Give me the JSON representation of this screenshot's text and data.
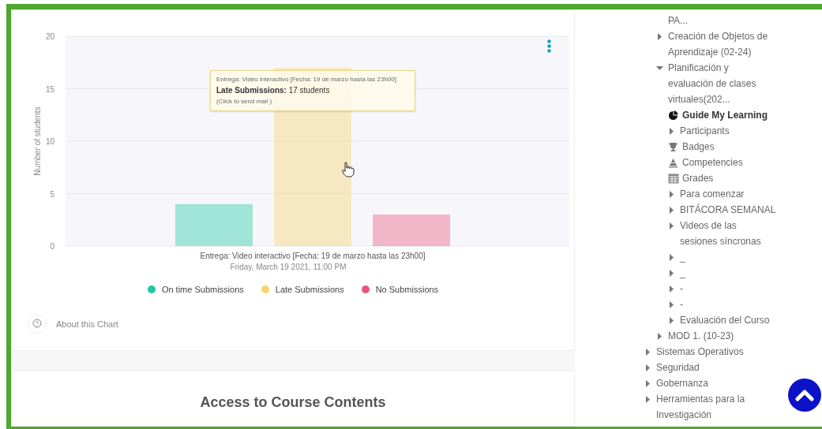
{
  "chart_card": {
    "chart_data": {
      "type": "bar",
      "ylabel": "Number of students",
      "categories": [
        "Entrega: Video interactivo [Fecha: 19 de marzo hasta las 23h00]"
      ],
      "series": [
        {
          "name": "On time Submissions",
          "color": "#1fc9a2",
          "values": [
            4
          ]
        },
        {
          "name": "Late Submissions",
          "color": "#f6d56b",
          "values": [
            17
          ]
        },
        {
          "name": "No Submissions",
          "color": "#e8557b",
          "values": [
            3
          ]
        }
      ],
      "ylim": [
        0,
        20
      ],
      "yticks": [
        0,
        5,
        10,
        15,
        20
      ],
      "grid": true
    },
    "date_label": "Friday, March 19 2021, 11:00 PM",
    "tooltip": {
      "title": "Entrega: Video interactivo [Fecha: 19 de marzo hasta las 23h00]",
      "value": "**Late Submissions:** 17 students",
      "hint": "(Click to send mail )"
    },
    "about_link": "About this Chart"
  },
  "next_card": {
    "title": "Access to Course Contents"
  },
  "sidebar": {
    "tree": [
      {
        "kind": "group",
        "children": [
          {
            "kind": "text",
            "label": "PA...",
            "selected": false
          },
          {
            "kind": "branch",
            "label": "Creación de Objetos de Aprendizaje (02-24)",
            "expanded": false,
            "selected": false
          },
          {
            "kind": "branch",
            "label": "Planificación y evaluación de clases virtuales(202...",
            "expanded": true,
            "selected": false,
            "children": [
              {
                "kind": "report",
                "label": "Guide My Learning",
                "selected": true
              },
              {
                "kind": "branch",
                "label": "Participants",
                "expanded": false,
                "selected": false
              },
              {
                "kind": "badges",
                "label": "Badges",
                "selected": false
              },
              {
                "kind": "competencies",
                "label": "Competencies",
                "selected": false
              },
              {
                "kind": "grades",
                "label": "Grades",
                "selected": false
              },
              {
                "kind": "branch",
                "label": "Para comenzar",
                "expanded": false,
                "selected": false
              },
              {
                "kind": "branch",
                "label": "BITÁCORA SEMANAL",
                "expanded": false,
                "selected": false
              },
              {
                "kind": "branch",
                "label": "Videos de las sesiones síncronas",
                "expanded": false,
                "selected": false
              },
              {
                "kind": "branch",
                "label": "_",
                "expanded": false,
                "selected": false
              },
              {
                "kind": "branch",
                "label": "_",
                "expanded": false,
                "selected": false
              },
              {
                "kind": "branch",
                "label": "-",
                "expanded": false,
                "selected": false
              },
              {
                "kind": "branch",
                "label": "-",
                "expanded": false,
                "selected": false
              },
              {
                "kind": "branch",
                "label": "Evaluación del Curso",
                "expanded": false,
                "selected": false
              }
            ]
          },
          {
            "kind": "branch",
            "label": "MOD 1. (10-23)",
            "expanded": false,
            "selected": false
          }
        ]
      },
      {
        "kind": "branch",
        "label": "Sistemas Operativos",
        "expanded": false,
        "selected": false
      },
      {
        "kind": "branch",
        "label": "Seguridad",
        "expanded": false,
        "selected": false
      },
      {
        "kind": "branch",
        "label": "Gobernanza",
        "expanded": false,
        "selected": false
      },
      {
        "kind": "branch",
        "label": "Herramientas para la Investigación",
        "expanded": false,
        "selected": false
      }
    ]
  }
}
